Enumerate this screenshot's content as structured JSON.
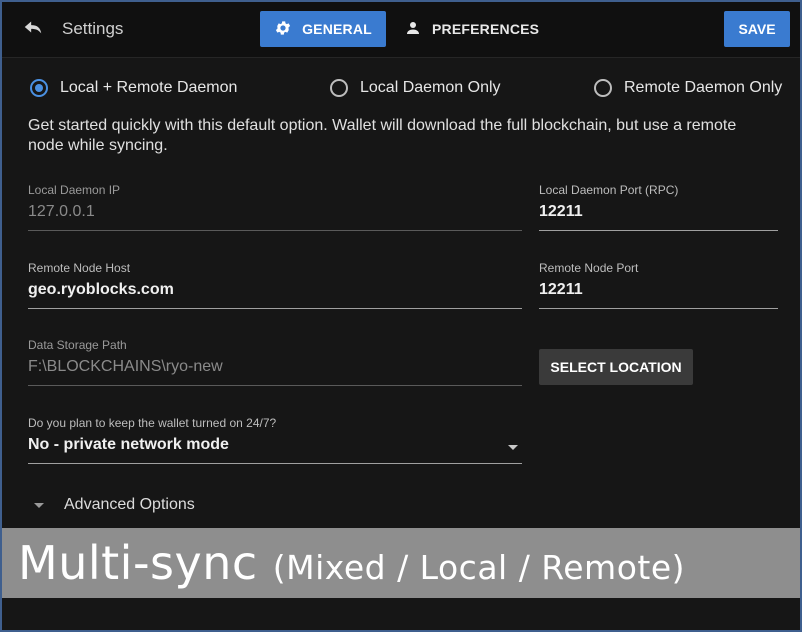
{
  "header": {
    "title": "Settings",
    "tabs": [
      {
        "label": "GENERAL",
        "icon": "gear-icon",
        "active": true
      },
      {
        "label": "PREFERENCES",
        "icon": "person-icon",
        "active": false
      }
    ],
    "save_label": "SAVE",
    "accent_color": "#3a7bd0"
  },
  "daemon_mode": {
    "options": [
      {
        "label": "Local + Remote Daemon",
        "selected": true
      },
      {
        "label": "Local Daemon Only",
        "selected": false
      },
      {
        "label": "Remote Daemon Only",
        "selected": false
      }
    ],
    "description": "Get started quickly with this default option. Wallet will download the full blockchain, but use a remote node while syncing."
  },
  "fields": {
    "local_daemon_ip": {
      "label": "Local Daemon IP",
      "value": "127.0.0.1"
    },
    "local_daemon_port": {
      "label": "Local Daemon Port (RPC)",
      "value": "12211"
    },
    "remote_node_host": {
      "label": "Remote Node Host",
      "value": "geo.ryoblocks.com"
    },
    "remote_node_port": {
      "label": "Remote Node Port",
      "value": "12211"
    },
    "data_storage_path": {
      "label": "Data Storage Path",
      "value": "F:\\BLOCKCHAINS\\ryo-new"
    },
    "select_location_label": "SELECT LOCATION",
    "uptime": {
      "label": "Do you plan to keep the wallet turned on 24/7?",
      "value": "No - private network mode"
    }
  },
  "advanced_options_label": "Advanced Options",
  "banner": {
    "main": "Multi-sync",
    "sub": "(Mixed / Local / Remote)"
  }
}
